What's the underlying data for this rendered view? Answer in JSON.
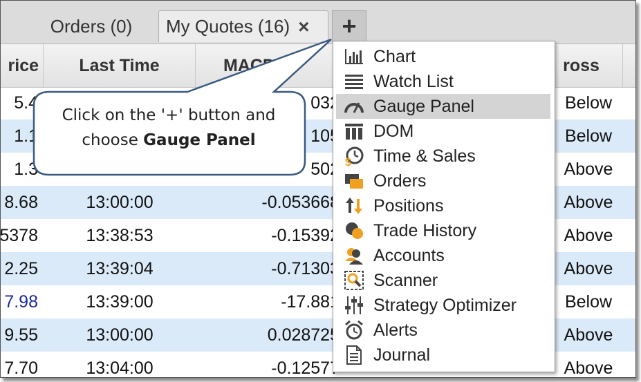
{
  "tabs": {
    "orders_label": "Orders (0)",
    "quotes_label": "My Quotes (16)",
    "close_glyph": "×",
    "plus_glyph": "+"
  },
  "table": {
    "headers": {
      "price": "rice",
      "last_time": "Last Time",
      "macd": "MACD-M",
      "cross": "ross"
    },
    "rows": [
      {
        "price": "5.4",
        "time": "",
        "macd": "032",
        "cross": "Below",
        "alt": false
      },
      {
        "price": "1.1",
        "time": "",
        "macd": "105",
        "cross": "Below",
        "alt": true
      },
      {
        "price": "1.3",
        "time": "",
        "macd": "502",
        "cross": "Above",
        "alt": false
      },
      {
        "price": "8.68",
        "time": "13:00:00",
        "macd": "-0.053668",
        "cross": "Above",
        "alt": true
      },
      {
        "price": "5378",
        "time": "13:38:53",
        "macd": "-0.15392",
        "cross": "Above",
        "alt": false
      },
      {
        "price": "2.25",
        "time": "13:39:04",
        "macd": "-0.71303",
        "cross": "Above",
        "alt": true
      },
      {
        "price": "7.98",
        "time": "13:39:00",
        "macd": "-17.881",
        "cross": "Below",
        "alt": false,
        "blue": true
      },
      {
        "price": "9.55",
        "time": "13:00:00",
        "macd": "0.028725",
        "cross": "Above",
        "alt": true
      },
      {
        "price": "7.70",
        "time": "13:04:00",
        "macd": "-0.12577",
        "cross": "Above",
        "alt": false
      }
    ]
  },
  "callout": {
    "line1": "Click on the '+' button and",
    "line2_prefix": "choose ",
    "line2_bold": "Gauge Panel"
  },
  "menu": {
    "items": [
      {
        "label": "Chart",
        "icon": "chart-icon"
      },
      {
        "label": "Watch List",
        "icon": "watch-list-icon"
      },
      {
        "label": "Gauge Panel",
        "icon": "gauge-icon",
        "highlighted": true
      },
      {
        "label": "DOM",
        "icon": "dom-icon"
      },
      {
        "label": "Time & Sales",
        "icon": "time-sales-icon"
      },
      {
        "label": "Orders",
        "icon": "orders-icon"
      },
      {
        "label": "Positions",
        "icon": "positions-icon"
      },
      {
        "label": "Trade History",
        "icon": "trade-history-icon"
      },
      {
        "label": "Accounts",
        "icon": "accounts-icon"
      },
      {
        "label": "Scanner",
        "icon": "scanner-icon"
      },
      {
        "label": "Strategy Optimizer",
        "icon": "strategy-optimizer-icon"
      },
      {
        "label": "Alerts",
        "icon": "alarm-clock-icon"
      },
      {
        "label": "Journal",
        "icon": "journal-icon"
      }
    ]
  },
  "colors": {
    "alt_row": "#dbeaf9",
    "highlight": "#d4d4d4",
    "accent_orange": "#f0a020",
    "callout_border": "#3a5a80"
  }
}
